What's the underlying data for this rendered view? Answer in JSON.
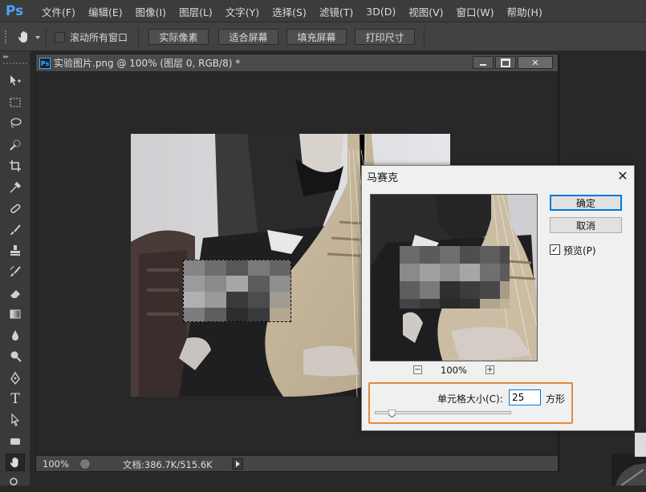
{
  "app": {
    "logo": "Ps",
    "menu": [
      "文件(F)",
      "编辑(E)",
      "图像(I)",
      "图层(L)",
      "文字(Y)",
      "选择(S)",
      "滤镜(T)",
      "3D(D)",
      "视图(V)",
      "窗口(W)",
      "帮助(H)"
    ]
  },
  "options": {
    "tool_icon": "hand-icon",
    "scroll_all_label": "滚动所有窗口",
    "scroll_all_checked": false,
    "buttons": [
      "实际像素",
      "适合屏幕",
      "填充屏幕",
      "打印尺寸"
    ]
  },
  "document": {
    "title": "实验图片.png @ 100% (图层 0, RGB/8) *",
    "badge": "Ps",
    "zoom": "100%",
    "doc_info": "文档:386.7K/515.6K"
  },
  "dialog": {
    "title": "马赛克",
    "ok_label": "确定",
    "cancel_label": "取消",
    "preview_label": "预览(P)",
    "preview_checked": true,
    "zoom": "100%",
    "zoom_out": "−",
    "zoom_in": "+",
    "cell_size_label": "单元格大小(C):",
    "cell_size_value": "25",
    "unit_label": "方形",
    "slider_position": 0.04
  },
  "colors": {
    "accent": "#4aa3ff",
    "highlight": "#e3893a",
    "ok_border": "#0078d7"
  }
}
